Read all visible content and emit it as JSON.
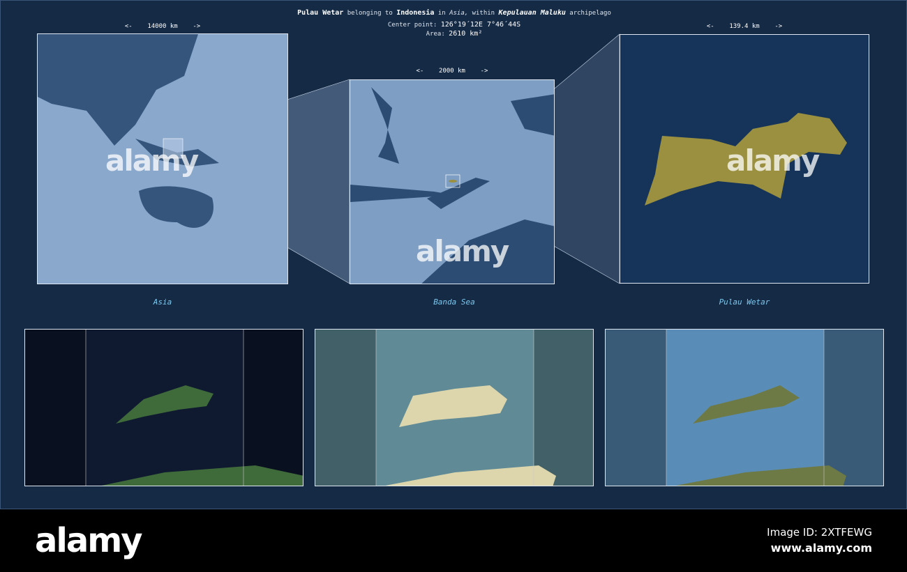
{
  "header": {
    "name": "Pulau Wetar",
    "t1": "belonging to",
    "country": "Indonesia",
    "t2": "in",
    "continent": "Asia,",
    "t3": "within",
    "archipelago": "Kepulauan Maluku",
    "t4": "archipelago",
    "center_label": "Center point:",
    "center_value": "126°19´12E  7°46´44S",
    "area_label": "Area:",
    "area_value": "2610 km²"
  },
  "panels": [
    {
      "scale": "<-    14000 km    ->",
      "label": "Asia"
    },
    {
      "scale": "<-    2000 km    ->",
      "label": "Banda Sea"
    },
    {
      "scale": "<-    139.4 km    ->",
      "label": "Pulau Wetar"
    }
  ],
  "watermark": "alamy",
  "footer": {
    "logo": "alamy",
    "image_id": "Image ID: 2XTFEWG",
    "url": "www.alamy.com"
  },
  "colors": {
    "background": "#152a45",
    "island": "#9a9040",
    "land": "#28476e",
    "sea": "#8aa8cc"
  }
}
